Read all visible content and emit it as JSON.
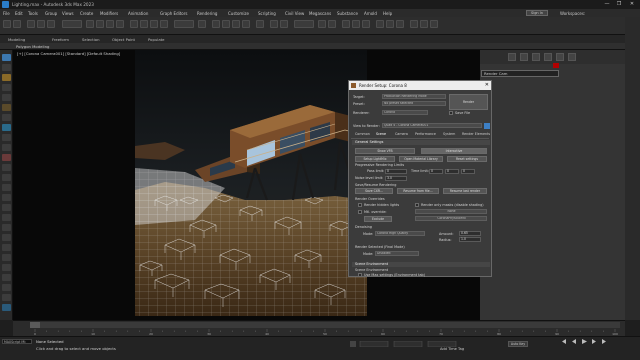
{
  "window": {
    "title": "Lighting.max - Autodesk 3ds Max 2023",
    "controls": [
      "—",
      "❐",
      "✕"
    ]
  },
  "menu": {
    "items": [
      "File",
      "Edit",
      "Tools",
      "Group",
      "Views",
      "Create",
      "Modifiers",
      "Animation",
      "Graph Editors",
      "Rendering",
      "Customize",
      "Scripting",
      "Civil View",
      "Megascans",
      "Substance",
      "Arnold",
      "Help"
    ],
    "sign_in": "Sign In",
    "workspaces": "Workspaces:"
  },
  "ribbon": {
    "tabs": [
      "Modeling",
      "Freeform",
      "Selection",
      "Object Paint",
      "Populate"
    ],
    "sub_tab": "Polygon Modeling"
  },
  "viewport": {
    "label": "[+] [Corona Camera001] [Standard] [Default Shading]"
  },
  "command_panel": {
    "object_name": "Render Cam",
    "color": "#b10000"
  },
  "timeline": {
    "ticks": [
      "0",
      "10",
      "20",
      "30",
      "40",
      "50",
      "60",
      "70",
      "80",
      "90",
      "100"
    ]
  },
  "status": {
    "maxscript": "MAXScript Mi:",
    "line1": "None Selected",
    "line2": "Click and drag to select and move objects",
    "auto_key": "Auto Key",
    "add_time_tag": "Add Time Tag"
  },
  "dialog": {
    "title": "Render Setup: Corona 8",
    "close": "✕",
    "rows": {
      "target_label": "Target:",
      "target_value": "Production Rendering Mode",
      "preset_label": "Preset:",
      "preset_value": "No preset selected",
      "renderer_label": "Renderer:",
      "renderer_value": "Corona",
      "save_file": "Save File",
      "view_label": "View to Render:",
      "view_value": "Quad 4 - Corona Camera001",
      "render_button": "Render"
    },
    "tabs": [
      "Common",
      "Scene",
      "Camera",
      "Performance",
      "System",
      "Render Elements"
    ],
    "active_tab": "Scene",
    "general": {
      "header": "General Settings",
      "show_vfb": "Show VFB",
      "interactive": "Interactive",
      "setup_lightmix": "Setup LightMix",
      "open_material_library": "Open Material Library",
      "reset_settings": "Reset settings",
      "progressive_header": "Progressive Rendering Limits",
      "pass_limit_label": "Pass limit:",
      "pass_limit_value": "0",
      "time_limit_label": "Time limit:",
      "time_limit_value": "0",
      "noise_limit_label": "Noise level limit:",
      "noise_limit_value": "3.0",
      "resume_header": "Save/Resume Rendering",
      "save_cxr": "Save CXR...",
      "resume_from_file": "Resume from file...",
      "resume_last": "Resume last render",
      "overrides_header": "Render Overrides",
      "render_hidden": "Render hidden lights",
      "render_only_masks": "Render only masks (disable shading)",
      "mtl_override": "Mtl. override:",
      "mtl_override_value": "None",
      "exclude": "Exclude",
      "exclude_value": "CoronaPhysicalMtl",
      "denoising_header": "Denoising",
      "denoise_mode_label": "Mode:",
      "denoise_mode_value": "Corona High Quality",
      "amount_label": "Amount:",
      "amount_value": "0.65",
      "radius_label": "Radius:",
      "radius_value": "1.0",
      "selected_header": "Render Selected (Final Mode)",
      "selected_mode_label": "Mode:",
      "selected_mode_value": "Disabled"
    },
    "scene_env": {
      "header": "Scene Environment",
      "sub": "Scene Environment",
      "use_max": "Use Max settings (Environment tab)"
    }
  }
}
